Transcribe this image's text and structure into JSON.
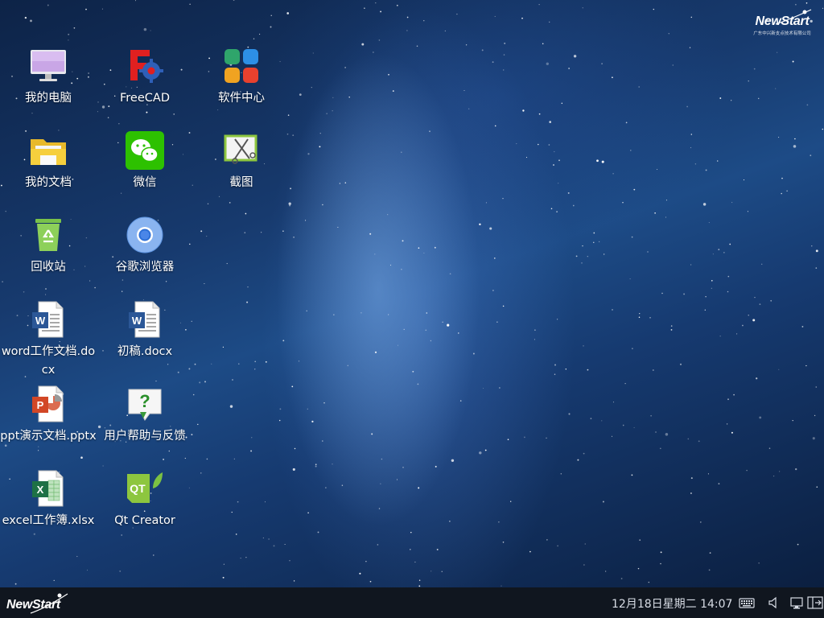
{
  "desktop": {
    "brand": {
      "name": "NewStart",
      "subtitle": "广东中兴新支点技术有限公司"
    },
    "icons": [
      {
        "label": "我的电脑",
        "icon": "computer-icon"
      },
      {
        "label": "FreeCAD",
        "icon": "freecad-icon"
      },
      {
        "label": "软件中心",
        "icon": "software-center-icon"
      },
      {
        "label": "我的文档",
        "icon": "folder-icon"
      },
      {
        "label": "微信",
        "icon": "wechat-icon"
      },
      {
        "label": "截图",
        "icon": "screenshot-icon"
      },
      {
        "label": "回收站",
        "icon": "trash-icon"
      },
      {
        "label": "谷歌浏览器",
        "icon": "chrome-icon"
      },
      {
        "label": "word工作文档.docx",
        "icon": "word-doc-icon"
      },
      {
        "label": "初稿.docx",
        "icon": "word-doc-icon"
      },
      {
        "label": "ppt演示文档.pptx",
        "icon": "ppt-doc-icon"
      },
      {
        "label": "用户帮助与反馈",
        "icon": "help-icon"
      },
      {
        "label": "excel工作簿.xlsx",
        "icon": "excel-doc-icon"
      },
      {
        "label": "Qt Creator",
        "icon": "qt-creator-icon"
      }
    ]
  },
  "taskbar": {
    "start_brand": "NewStart",
    "clock": "12月18日星期二 14:07",
    "tray_icons": [
      "keyboard-icon",
      "volume-icon",
      "network-icon",
      "desktop-switch-icon"
    ]
  },
  "colors": {
    "taskbar_bg": "#10161f",
    "sky_dark": "#0b1f40",
    "sky_mid": "#1d4b86",
    "wechat_green": "#2dc100",
    "qt_green": "#8dc63f"
  }
}
